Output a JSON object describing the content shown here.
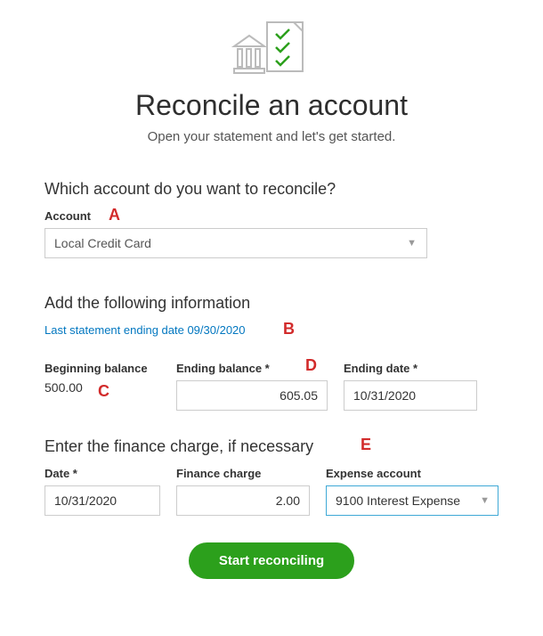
{
  "header": {
    "title": "Reconcile an account",
    "subtitle": "Open your statement and let's get started."
  },
  "section1": {
    "heading": "Which account do you want to reconcile?",
    "account_label": "Account",
    "account_value": "Local Credit Card"
  },
  "section2": {
    "heading": "Add the following information",
    "last_statement": "Last statement ending date 09/30/2020",
    "beginning_balance_label": "Beginning balance",
    "beginning_balance_value": "500.00",
    "ending_balance_label": "Ending balance *",
    "ending_balance_value": "605.05",
    "ending_date_label": "Ending date *",
    "ending_date_value": "10/31/2020"
  },
  "section3": {
    "heading": "Enter the finance charge, if necessary",
    "date_label": "Date *",
    "date_value": "10/31/2020",
    "finance_charge_label": "Finance charge",
    "finance_charge_value": "2.00",
    "expense_account_label": "Expense account",
    "expense_account_value": "9100 Interest Expense"
  },
  "actions": {
    "start_button": "Start reconciling"
  },
  "annotations": {
    "A": "A",
    "B": "B",
    "C": "C",
    "D": "D",
    "E": "E"
  }
}
